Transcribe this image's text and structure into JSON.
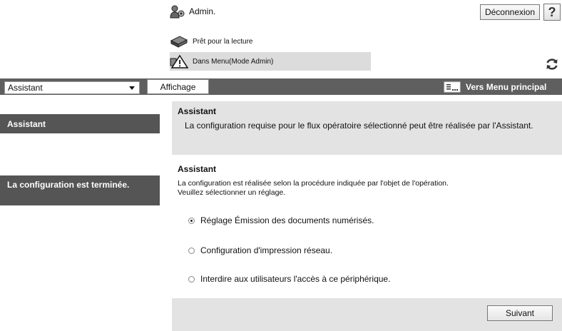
{
  "header": {
    "user_name": "Admin.",
    "logout_label": "Déconnexion",
    "help_label": "?",
    "status_ready": "Prêt pour la lecture",
    "status_menu": "Dans Menu(Mode Admin)"
  },
  "menubar": {
    "select_value": "Assistant",
    "display_tab": "Affichage",
    "main_menu_link": "Vers Menu principal"
  },
  "sidebar": {
    "assistant": "Assistant",
    "done": "La configuration est terminée."
  },
  "intro": {
    "title": "Assistant",
    "text": "La configuration requise pour le flux opératoire sélectionné peut être réalisée par l'Assistant."
  },
  "section": {
    "title": "Assistant",
    "desc_line1": "La configuration est réalisée selon la procédure indiquée par l'objet de l'opération.",
    "desc_line2": "Veuillez sélectionner un réglage."
  },
  "options": [
    {
      "label": "Réglage Émission des documents numérisés.",
      "selected": true
    },
    {
      "label": "Configuration d'impression réseau.",
      "selected": false
    },
    {
      "label": "Interdire aux utilisateurs l'accès à ce périphérique.",
      "selected": false
    }
  ],
  "footer": {
    "next_label": "Suivant"
  }
}
